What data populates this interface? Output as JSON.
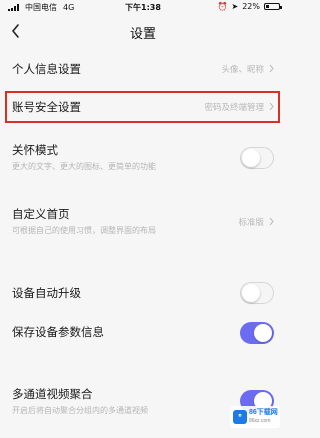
{
  "status_bar": {
    "carrier": "中国电信",
    "network": "4G",
    "time": "下午1:38",
    "battery": "22%"
  },
  "nav": {
    "title": "设置"
  },
  "rows": {
    "personal_info": {
      "title": "个人信息设置",
      "value": "头像、昵称"
    },
    "account_security": {
      "title": "账号安全设置",
      "value": "密码及终端管理"
    },
    "care_mode": {
      "title": "关怀模式",
      "subtitle": "更大的文字、更大的图标、更简单的功能",
      "toggle_on": false
    },
    "custom_home": {
      "title": "自定义首页",
      "subtitle": "可根据自己的使用习惯，调整界面的布局",
      "value": "标准版"
    },
    "auto_upgrade": {
      "title": "设备自动升级",
      "toggle_on": false
    },
    "save_params": {
      "title": "保存设备参数信息",
      "toggle_on": true
    },
    "multi_channel": {
      "title": "多通道视频聚合",
      "subtitle": "开启后将自动聚合分组内的多通道视频",
      "toggle_on": true
    }
  },
  "watermark": {
    "logo_text": "ᴮ",
    "main": "86下载网",
    "sub": "86xz.com"
  },
  "colors": {
    "toggle_on": "#6b6cf2",
    "highlight_border": "#d93025"
  }
}
